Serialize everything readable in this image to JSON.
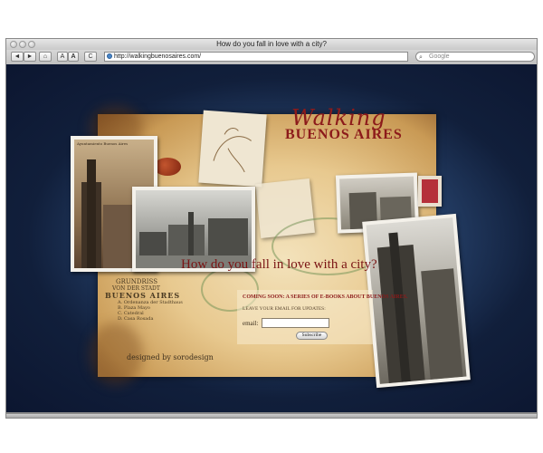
{
  "window": {
    "title": "How do you fall in love with a city?"
  },
  "toolbar": {
    "back_label": "◄",
    "forward_label": "►",
    "home_label": "⌂",
    "text_smaller_label": "A",
    "text_bigger_label": "A",
    "reload_label": "C",
    "address_url": "http://walkingbuenosaires.com/",
    "search_placeholder": "Google"
  },
  "page": {
    "logo_walking": "Walking",
    "logo_buenos_aires": "BUENOS AIRES",
    "tagline": "How do you fall in love with a city?",
    "map_title_line1": "GRUNDRISS",
    "map_title_line2": "VON DER STADT",
    "map_title_line3": "BUENOS AIRES",
    "map_legend_1": "A. Ordenanza der Stadthaus",
    "map_legend_2": "B. Plaza Mayo",
    "map_legend_3": "C. Catedral",
    "map_legend_4": "D. Casa Rosada",
    "photo1_caption": "Ayuntamiento Buenos Aires",
    "credit": "designed by sorodesign"
  },
  "signup": {
    "heading": "Coming soon: a series of e-books about Buenos Aires.",
    "subtext": "Leave your email for updates:",
    "email_label": "email:",
    "email_value": "",
    "subscribe_label": "Subscribe"
  }
}
